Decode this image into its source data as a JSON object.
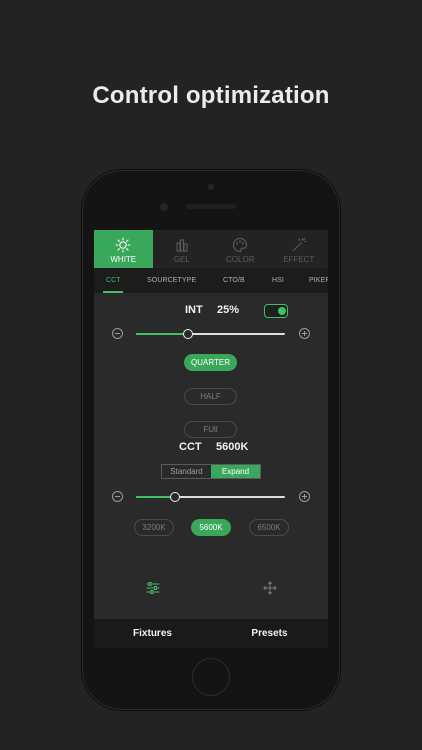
{
  "headline": "Control optimization",
  "mode_tabs": [
    {
      "label": "WHITE",
      "icon": "sun-icon",
      "active": true
    },
    {
      "label": "GEL",
      "icon": "gel-icon",
      "active": false
    },
    {
      "label": "COLOR",
      "icon": "palette-icon",
      "active": false
    },
    {
      "label": "EFFECT",
      "icon": "magic-wand-icon",
      "active": false
    }
  ],
  "sub_tabs": [
    {
      "label": "CCT",
      "active": true
    },
    {
      "label": "SOURCETYPE",
      "active": false
    },
    {
      "label": "CTO/B",
      "active": false
    },
    {
      "label": "HSI",
      "active": false
    },
    {
      "label": "PIKER",
      "active": false
    }
  ],
  "intensity": {
    "label": "INT",
    "value": "25%",
    "toggle_on": true,
    "slider_fraction": 0.35,
    "presets": [
      {
        "label": "QUARTER",
        "active": true
      },
      {
        "label": "HALF",
        "active": false
      },
      {
        "label": "FUll",
        "active": false
      }
    ]
  },
  "cct": {
    "label": "CCT",
    "value": "5600K",
    "modes": [
      {
        "label": "Standard",
        "active": false
      },
      {
        "label": "Expand",
        "active": true
      }
    ],
    "slider_fraction": 0.26,
    "presets": [
      {
        "label": "3200K",
        "active": false
      },
      {
        "label": "5600K",
        "active": true
      },
      {
        "label": "6500K",
        "active": false
      }
    ]
  },
  "bottom_nav": {
    "fixtures": "Fixtures",
    "presets": "Presets"
  },
  "colors": {
    "accent": "#3aa85a",
    "screen_bg": "#2a2a2a",
    "page_bg": "#232323"
  }
}
